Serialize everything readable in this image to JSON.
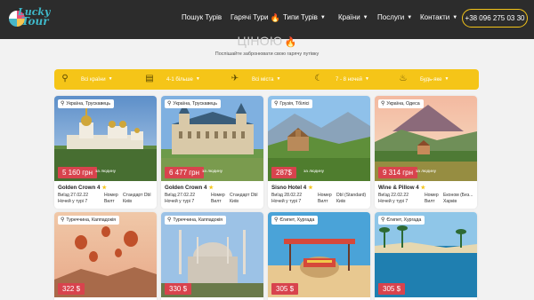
{
  "header": {
    "logo": {
      "line1": "Lucky",
      "line2": "Tour"
    },
    "nav": [
      {
        "label": "Пошук Турів"
      },
      {
        "label": "Гарячі Тури"
      },
      {
        "label": "Типи Турів"
      },
      {
        "label": "Країни"
      },
      {
        "label": "Послуги"
      },
      {
        "label": "Контакти"
      }
    ],
    "phone": "+38 096 275 03 30"
  },
  "hero": {
    "title": "ЦІНОЮ",
    "subtitle": "Поспішайте забронювати свою гарячу путівку"
  },
  "filter": {
    "country": "Всі країни",
    "people": "4-1 більше",
    "city": "Всі міста",
    "nights": "7 - 8 ночей",
    "meal": "Будь-яке"
  },
  "colors": {
    "accent": "#f5c518",
    "price": "#d8434d",
    "header": "#2c2c2c"
  },
  "cards": [
    {
      "location": "Україна, Трускавець",
      "price": "5 160 грн",
      "per": "за людину",
      "hotel": "Golden Crown 4",
      "stars": 1,
      "departure": "Виїзд 27.02.22",
      "nights": "Ночей у турі 7",
      "room_label": "Номер",
      "room": "Стандарт Dbl",
      "meal": "Вилт",
      "city": "Київ"
    },
    {
      "location": "Україна, Трускавець",
      "price": "6 477 грн",
      "per": "за людину",
      "hotel": "Golden Crown 4",
      "stars": 1,
      "departure": "Виїзд 27.02.22",
      "nights": "Ночей у турі 7",
      "room_label": "Номер",
      "room": "Стандарт Dbl",
      "meal": "Вилт",
      "city": "Київ"
    },
    {
      "location": "Грузія, Тбілісі",
      "price": "287$",
      "per": "за людину",
      "hotel": "Sisno Hotel 4",
      "stars": 1,
      "departure": "Виїзд 28.02.22",
      "nights": "Ночей у турі 7",
      "room_label": "Номер",
      "room": "Dbl (Standard)",
      "meal": "Вилт",
      "city": "Київ"
    },
    {
      "location": "Україна, Одеса",
      "price": "9 314 грн",
      "per": "за людину",
      "hotel": "Wine & Pillow 4",
      "stars": 1,
      "departure": "Виїзд 22.02.22",
      "nights": "Ночей у турі 7",
      "room_label": "Номер",
      "room": "Економ (Без...",
      "meal": "Вилт",
      "city": "Харків"
    },
    {
      "location": "Туреччина, Каппадокія",
      "price": "322 $"
    },
    {
      "location": "Туреччина, Каппадокія",
      "price": "330 $"
    },
    {
      "location": "Єгипет, Хургада",
      "price": "305 $"
    },
    {
      "location": "Єгипет, Хургада",
      "price": "305 $"
    }
  ]
}
